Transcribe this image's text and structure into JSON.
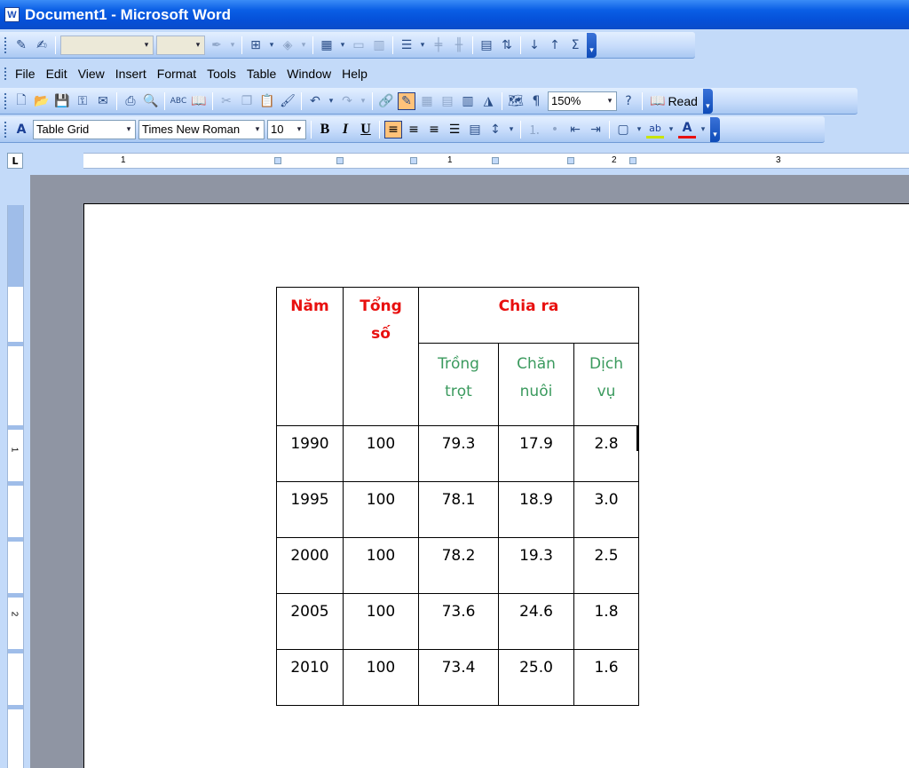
{
  "window": {
    "title": "Document1 - Microsoft Word",
    "app_icon": "W"
  },
  "menu": [
    "File",
    "Edit",
    "View",
    "Insert",
    "Format",
    "Tools",
    "Table",
    "Window",
    "Help"
  ],
  "standard_toolbar": {
    "zoom": "150%",
    "read_label": "Read"
  },
  "formatting_toolbar": {
    "style": "Table Grid",
    "font": "Times New Roman",
    "size": "10",
    "bold": "B",
    "italic": "I",
    "underline": "U"
  },
  "ruler": {
    "tab_selector": "L",
    "h_numbers": [
      "1",
      "1",
      "2",
      "3"
    ],
    "v_numbers": [
      "1",
      "2"
    ]
  },
  "table": {
    "header": {
      "year": "Năm",
      "total_line1": "Tổng",
      "total_line2": "số",
      "breakdown": "Chia ra"
    },
    "subheader": {
      "crop_line1": "Trồng",
      "crop_line2": "trọt",
      "livestock_line1": "Chăn",
      "livestock_line2": "nuôi",
      "service_line1": "Dịch",
      "service_line2": "vụ"
    },
    "rows": [
      [
        "1990",
        "100",
        "79.3",
        "17.9",
        "2.8"
      ],
      [
        "1995",
        "100",
        "78.1",
        "18.9",
        "3.0"
      ],
      [
        "2000",
        "100",
        "78.2",
        "19.3",
        "2.5"
      ],
      [
        "2005",
        "100",
        "73.6",
        "24.6",
        "1.8"
      ],
      [
        "2010",
        "100",
        "73.4",
        "25.0",
        "1.6"
      ]
    ]
  },
  "colors": {
    "header_red": "#e8100f",
    "subheader_green": "#3b9a5e",
    "titlebar_blue": "#0550d8",
    "toolbar_bg": "#c3daf9"
  }
}
